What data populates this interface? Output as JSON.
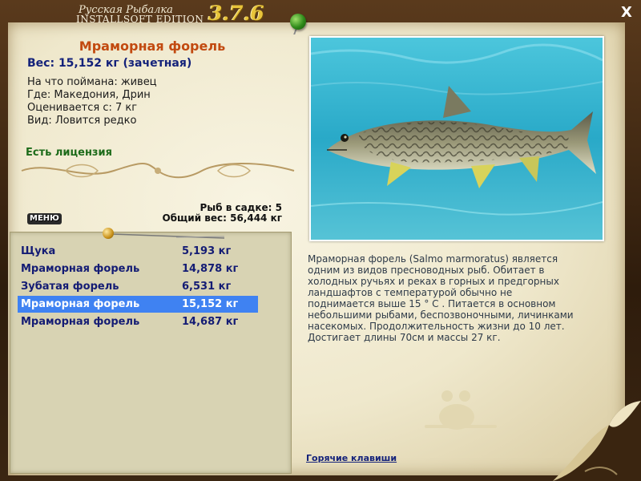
{
  "app": {
    "title_ru": "Русская Рыбалка",
    "title_en": "INSTALLSOFT EDITION",
    "version": "3.7.6",
    "close_label": "X"
  },
  "fish": {
    "name": "Мраморная форель",
    "weight_line": "Вес: 15,152 кг (зачетная)",
    "caught_on": "На что поймана: живец",
    "location": "Где: Македония, Дрин",
    "value_from": "Оценивается с: 7 кг",
    "rarity": "Вид: Ловится редко",
    "license": "Есть лицензия"
  },
  "keepnet": {
    "count_text": "Рыб в садке: 5",
    "total_text": "Общий вес: 56,444 кг"
  },
  "menu": {
    "label": "МЕНЮ"
  },
  "catch_list": [
    {
      "name": "Щука",
      "weight": "5,193 кг",
      "selected": false
    },
    {
      "name": "Мраморная форель",
      "weight": "14,878 кг",
      "selected": false
    },
    {
      "name": "Зубатая форель",
      "weight": "6,531 кг",
      "selected": false
    },
    {
      "name": "Мраморная форель",
      "weight": "15,152 кг",
      "selected": true
    },
    {
      "name": "Мраморная форель",
      "weight": "14,687 кг",
      "selected": false
    }
  ],
  "description": "Мраморная форель (Salmo marmoratus) является одним из видов пресноводных рыб. Обитает в холодных ручьях и реках в горных и предгорных ландшафтов с температурой обычно не поднимается выше 15 ° С . Питается в основном небольшими рыбами, беспозвоночными, личинками насекомых. Продолжительность жизни до 10 лет. Достигает длины 70см и массы 27 кг.",
  "hotkeys_label": "Горячие клавиши",
  "colors": {
    "selection": "#3f82f2",
    "fish_name": "#c24a10",
    "list_text": "#141c74",
    "license": "#1d6b1a"
  }
}
